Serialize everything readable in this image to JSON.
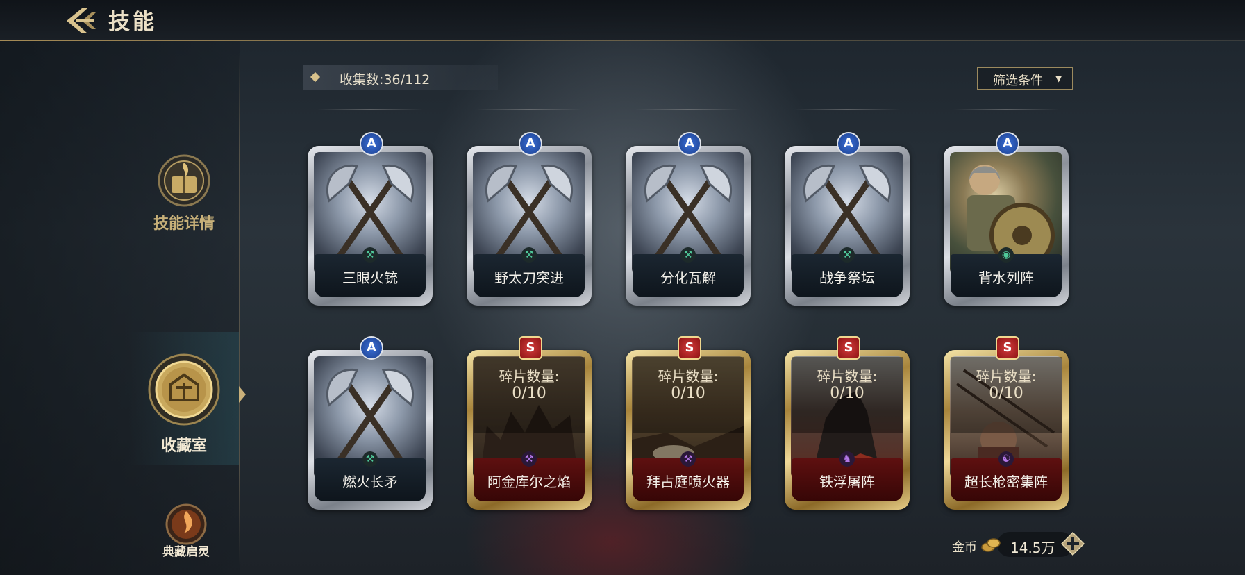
{
  "header": {
    "title": "技能"
  },
  "sidebar": {
    "items": [
      {
        "label": "技能详情",
        "active": false
      },
      {
        "label": "收藏室",
        "active": true
      },
      {
        "label": "典藏启灵",
        "active": false
      }
    ]
  },
  "collection": {
    "label": "收集数:36/112"
  },
  "filter": {
    "label": "筛选条件"
  },
  "cards": [
    {
      "name": "三眼火铳",
      "rank": "A"
    },
    {
      "name": "野太刀突进",
      "rank": "A"
    },
    {
      "name": "分化瓦解",
      "rank": "A"
    },
    {
      "name": "战争祭坛",
      "rank": "A"
    },
    {
      "name": "背水列阵",
      "rank": "A"
    },
    {
      "name": "燃火长矛",
      "rank": "A"
    },
    {
      "name": "阿金库尔之焰",
      "rank": "S",
      "fragment_label": "碎片数量:",
      "fragment_value": "0/10"
    },
    {
      "name": "拜占庭喷火器",
      "rank": "S",
      "fragment_label": "碎片数量:",
      "fragment_value": "0/10"
    },
    {
      "name": "铁浮屠阵",
      "rank": "S",
      "fragment_label": "碎片数量:",
      "fragment_value": "0/10"
    },
    {
      "name": "超长枪密集阵",
      "rank": "S",
      "fragment_label": "碎片数量:",
      "fragment_value": "0/10"
    }
  ],
  "currency": {
    "label": "金币",
    "value": "14.5万"
  },
  "colors": {
    "accent_gold": "#c9b07a",
    "rank_a_blue": "#3b6fd6",
    "rank_s_red": "#d23b3b"
  }
}
